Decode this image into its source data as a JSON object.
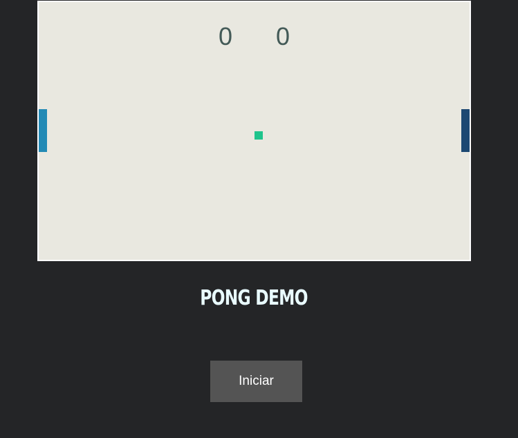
{
  "game": {
    "score_left": "0",
    "score_right": "0",
    "title": "PONG DEMO",
    "start_label": "Iniciar"
  },
  "colors": {
    "court": "#e9e8e0",
    "court_border": "#ffffff",
    "background": "#242527",
    "paddle_left": "#238ab5",
    "paddle_right": "#1d4872",
    "ball": "#1fc48c",
    "score": "#435a57",
    "button": "#545454"
  }
}
